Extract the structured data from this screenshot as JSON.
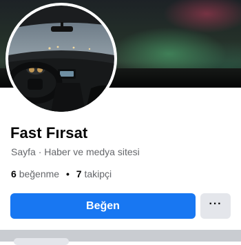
{
  "profile": {
    "name": "Fast Fırsat",
    "category": "Sayfa · Haber ve medya sitesi",
    "likes_count": "6",
    "likes_label": "beğenme",
    "separator": "•",
    "followers_count": "7",
    "followers_label": "takipçi"
  },
  "actions": {
    "like_label": "Beğen",
    "more_label": "···"
  },
  "colors": {
    "primary": "#1877f2",
    "secondary_button": "#e4e6eb",
    "muted_text": "#65676b"
  }
}
